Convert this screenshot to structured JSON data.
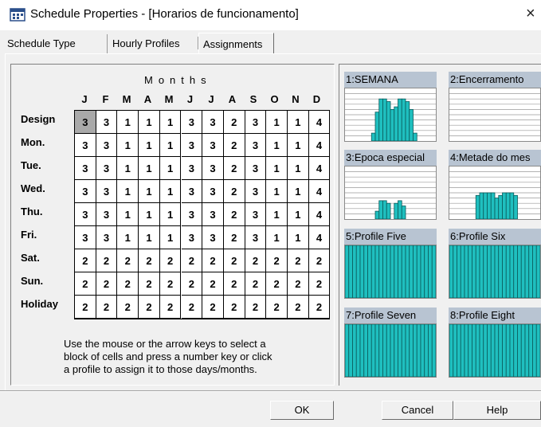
{
  "window": {
    "title": "Schedule Properties - [Horarios de funcionamento]",
    "close_symbol": "×",
    "icon": "calendar-app-icon"
  },
  "tabs": [
    {
      "label": "Schedule Type",
      "active": false
    },
    {
      "label": "Hourly Profiles",
      "active": false
    },
    {
      "label": "Assignments",
      "active": true
    }
  ],
  "months_title": "Months",
  "months": [
    "J",
    "F",
    "M",
    "A",
    "M",
    "J",
    "J",
    "A",
    "S",
    "O",
    "N",
    "D"
  ],
  "rows": [
    {
      "label": "Design",
      "values": [
        "3",
        "3",
        "1",
        "1",
        "1",
        "3",
        "3",
        "2",
        "3",
        "1",
        "1",
        "4"
      ]
    },
    {
      "label": "Mon.",
      "values": [
        "3",
        "3",
        "1",
        "1",
        "1",
        "3",
        "3",
        "2",
        "3",
        "1",
        "1",
        "4"
      ]
    },
    {
      "label": "Tue.",
      "values": [
        "3",
        "3",
        "1",
        "1",
        "1",
        "3",
        "3",
        "2",
        "3",
        "1",
        "1",
        "4"
      ]
    },
    {
      "label": "Wed.",
      "values": [
        "3",
        "3",
        "1",
        "1",
        "1",
        "3",
        "3",
        "2",
        "3",
        "1",
        "1",
        "4"
      ]
    },
    {
      "label": "Thu.",
      "values": [
        "3",
        "3",
        "1",
        "1",
        "1",
        "3",
        "3",
        "2",
        "3",
        "1",
        "1",
        "4"
      ]
    },
    {
      "label": "Fri.",
      "values": [
        "3",
        "3",
        "1",
        "1",
        "1",
        "3",
        "3",
        "2",
        "3",
        "1",
        "1",
        "4"
      ]
    },
    {
      "label": "Sat.",
      "values": [
        "2",
        "2",
        "2",
        "2",
        "2",
        "2",
        "2",
        "2",
        "2",
        "2",
        "2",
        "2"
      ]
    },
    {
      "label": "Sun.",
      "values": [
        "2",
        "2",
        "2",
        "2",
        "2",
        "2",
        "2",
        "2",
        "2",
        "2",
        "2",
        "2"
      ]
    },
    {
      "label": "Holiday",
      "values": [
        "2",
        "2",
        "2",
        "2",
        "2",
        "2",
        "2",
        "2",
        "2",
        "2",
        "2",
        "2"
      ]
    }
  ],
  "selected_cell": {
    "row": 0,
    "col": 0
  },
  "help_lines": [
    "Use the mouse or the arrow keys to select a",
    "block of cells and press a number key or click",
    "a profile to assign it to those days/months."
  ],
  "profiles": [
    {
      "title": "1:SEMANA",
      "bars": [
        0,
        0,
        0,
        0,
        0,
        0,
        0,
        0.15,
        0.55,
        0.8,
        0.8,
        0.75,
        0.6,
        0.65,
        0.8,
        0.8,
        0.75,
        0.6,
        0.15,
        0,
        0,
        0,
        0,
        0
      ]
    },
    {
      "title": "2:Encerramento",
      "bars": [
        0,
        0,
        0,
        0,
        0,
        0,
        0,
        0,
        0,
        0,
        0,
        0,
        0,
        0,
        0,
        0,
        0,
        0,
        0,
        0,
        0,
        0,
        0,
        0
      ]
    },
    {
      "title": "3:Epoca especial",
      "bars": [
        0,
        0,
        0,
        0,
        0,
        0,
        0,
        0,
        0.15,
        0.35,
        0.35,
        0.3,
        0,
        0.3,
        0.35,
        0.25,
        0,
        0,
        0,
        0,
        0,
        0,
        0,
        0
      ]
    },
    {
      "title": "4:Metade do mes",
      "bars": [
        0,
        0,
        0,
        0,
        0,
        0,
        0,
        0.45,
        0.5,
        0.5,
        0.5,
        0.5,
        0.4,
        0.45,
        0.5,
        0.5,
        0.5,
        0.45,
        0,
        0,
        0,
        0,
        0,
        0
      ]
    },
    {
      "title": "5:Profile Five",
      "bars": [
        1,
        1,
        1,
        1,
        1,
        1,
        1,
        1,
        1,
        1,
        1,
        1,
        1,
        1,
        1,
        1,
        1,
        1,
        1,
        1,
        1,
        1,
        1,
        1
      ]
    },
    {
      "title": "6:Profile Six",
      "bars": [
        1,
        1,
        1,
        1,
        1,
        1,
        1,
        1,
        1,
        1,
        1,
        1,
        1,
        1,
        1,
        1,
        1,
        1,
        1,
        1,
        1,
        1,
        1,
        1
      ]
    },
    {
      "title": "7:Profile Seven",
      "bars": [
        1,
        1,
        1,
        1,
        1,
        1,
        1,
        1,
        1,
        1,
        1,
        1,
        1,
        1,
        1,
        1,
        1,
        1,
        1,
        1,
        1,
        1,
        1,
        1
      ]
    },
    {
      "title": "8:Profile Eight",
      "bars": [
        1,
        1,
        1,
        1,
        1,
        1,
        1,
        1,
        1,
        1,
        1,
        1,
        1,
        1,
        1,
        1,
        1,
        1,
        1,
        1,
        1,
        1,
        1,
        1
      ]
    }
  ],
  "colors": {
    "bar_fill": "#1fbfbf",
    "bar_dark": "#0a5a5a",
    "profile_header": "#b8c4d2",
    "selected_cell": "#a9a9a9"
  },
  "buttons": {
    "ok": "OK",
    "cancel": "Cancel",
    "help": "Help"
  }
}
